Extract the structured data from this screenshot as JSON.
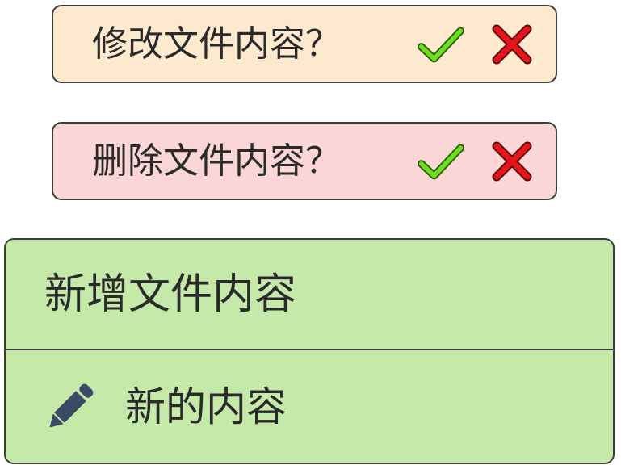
{
  "modify_prompt": {
    "question": "修改文件内容？",
    "confirm_icon": "check-icon",
    "cancel_icon": "close-icon",
    "background": "#fde9cd"
  },
  "delete_prompt": {
    "question": "删除文件内容？",
    "confirm_icon": "check-icon",
    "cancel_icon": "close-icon",
    "background": "#fbd6d6"
  },
  "add_panel": {
    "title": "新增文件内容",
    "input_value": "新的内容",
    "input_icon": "pencil-icon",
    "background": "#c5e9a9"
  },
  "colors": {
    "check": "#6be01c",
    "cross": "#e8141c",
    "border": "#3c3c3c",
    "pencil": "#3d4a66"
  }
}
